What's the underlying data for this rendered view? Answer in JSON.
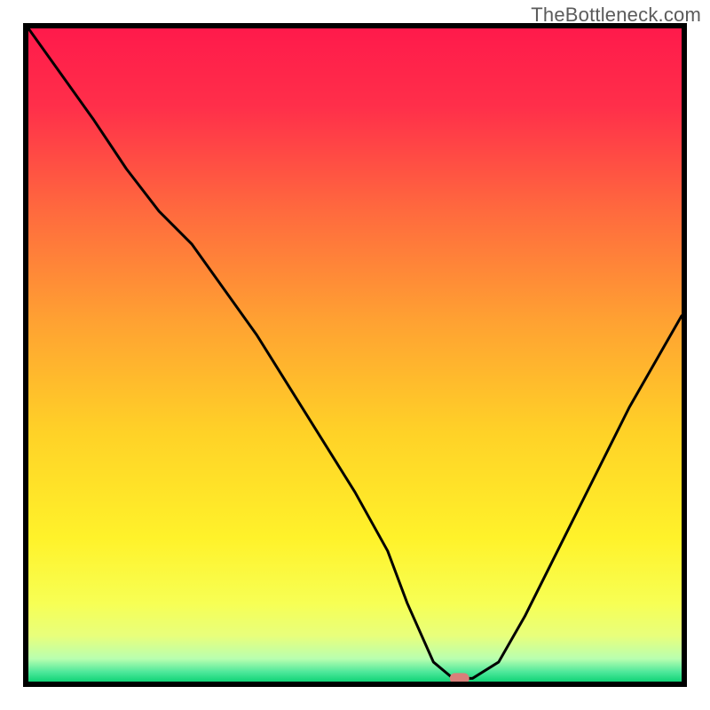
{
  "watermark": "TheBottleneck.com",
  "chart_data": {
    "type": "line",
    "title": "",
    "xlabel": "",
    "ylabel": "",
    "xlim": [
      0,
      100
    ],
    "ylim": [
      0,
      100
    ],
    "grid": false,
    "legend": false,
    "series": [
      {
        "name": "bottleneck-curve",
        "x": [
          0,
          5,
          10,
          15,
          20,
          25,
          30,
          35,
          40,
          45,
          50,
          55,
          58,
          62,
          65,
          68,
          72,
          76,
          80,
          84,
          88,
          92,
          96,
          100
        ],
        "y": [
          100,
          93,
          86,
          78.5,
          72,
          67,
          60,
          53,
          45,
          37,
          29,
          20,
          12,
          3,
          0.5,
          0.5,
          3,
          10,
          18,
          26,
          34,
          42,
          49,
          56
        ]
      }
    ],
    "marker": {
      "name": "optimal-point",
      "x": 66,
      "y": 0.5,
      "color": "#d97f7a"
    },
    "background_gradient_stops": [
      {
        "offset": 0.0,
        "color": "#ff1a4b"
      },
      {
        "offset": 0.12,
        "color": "#ff2f4a"
      },
      {
        "offset": 0.28,
        "color": "#ff6a3e"
      },
      {
        "offset": 0.45,
        "color": "#ffa232"
      },
      {
        "offset": 0.62,
        "color": "#ffd227"
      },
      {
        "offset": 0.78,
        "color": "#fff22a"
      },
      {
        "offset": 0.88,
        "color": "#f7ff54"
      },
      {
        "offset": 0.93,
        "color": "#e8ff7c"
      },
      {
        "offset": 0.965,
        "color": "#b9ffb0"
      },
      {
        "offset": 0.985,
        "color": "#4fe89b"
      },
      {
        "offset": 1.0,
        "color": "#11d477"
      }
    ],
    "frame_color": "#000000",
    "curve_color": "#000000"
  }
}
